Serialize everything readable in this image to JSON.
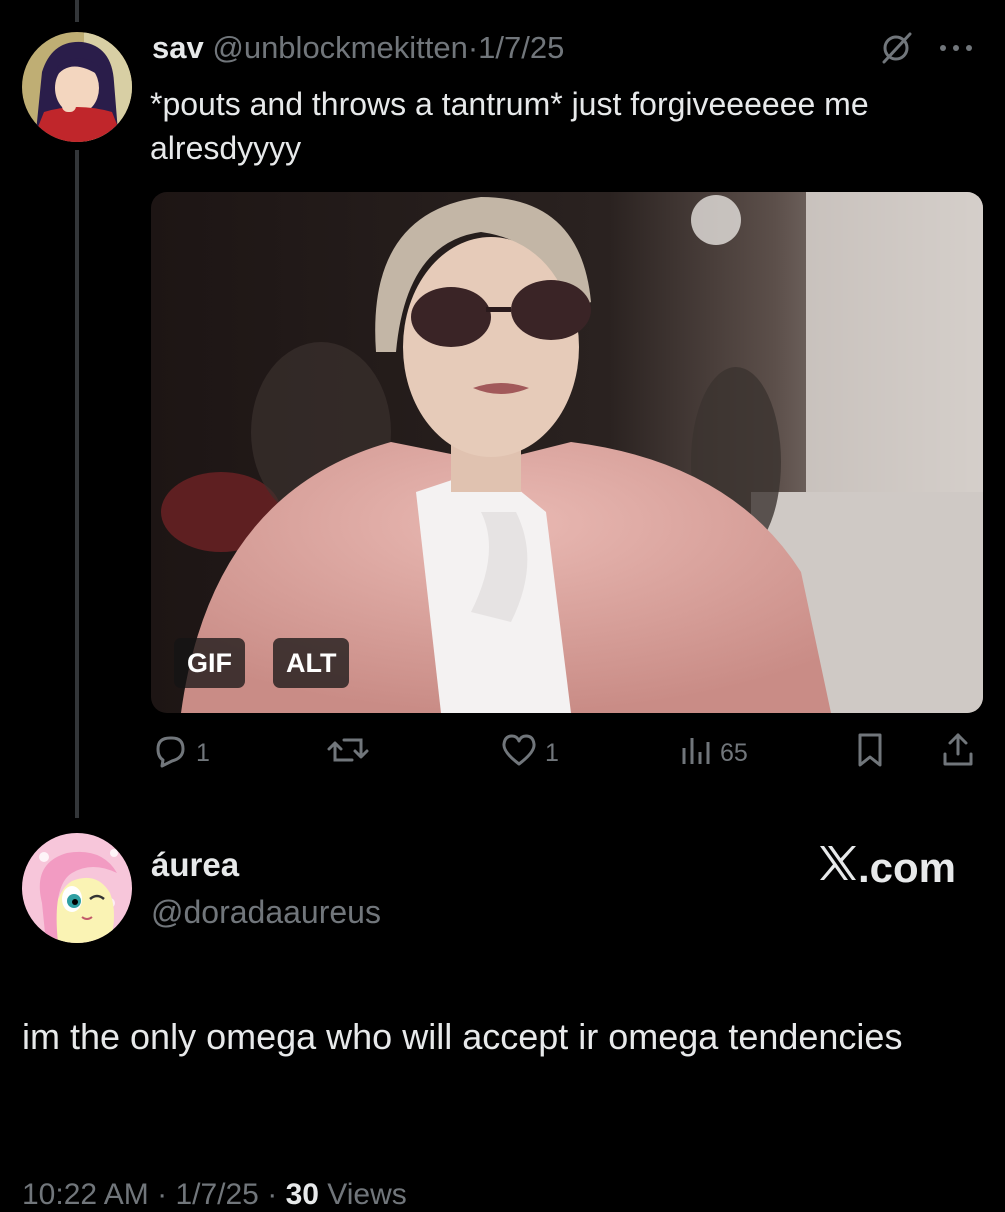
{
  "tweet": {
    "display_name": "sav",
    "handle": "@unblockmekitten",
    "separator": "·",
    "date": "1/7/25",
    "text": "*pouts and throws a tantrum* just forgiveeeeee me alresdyyyy",
    "media": {
      "gif_badge": "GIF",
      "alt_badge": "ALT"
    },
    "actions": {
      "replies": "1",
      "likes": "1",
      "views": "65"
    },
    "icons": [
      "translate-off-icon",
      "more-icon",
      "reply-icon",
      "retweet-icon",
      "like-icon",
      "views-icon",
      "bookmark-icon",
      "share-icon"
    ]
  },
  "reply": {
    "display_name": "áurea",
    "handle": "@doradaaureus",
    "brand": ".com",
    "text": "im the only omega who will accept ir omega tendencies",
    "footer": {
      "time": "10:22 AM",
      "separator": "·",
      "date": "1/7/25",
      "views_count": "30",
      "views_label": "Views"
    }
  },
  "colors": {
    "background": "#000000",
    "text": "#e7e9ea",
    "muted": "#71767b",
    "thread_line": "#333639"
  }
}
